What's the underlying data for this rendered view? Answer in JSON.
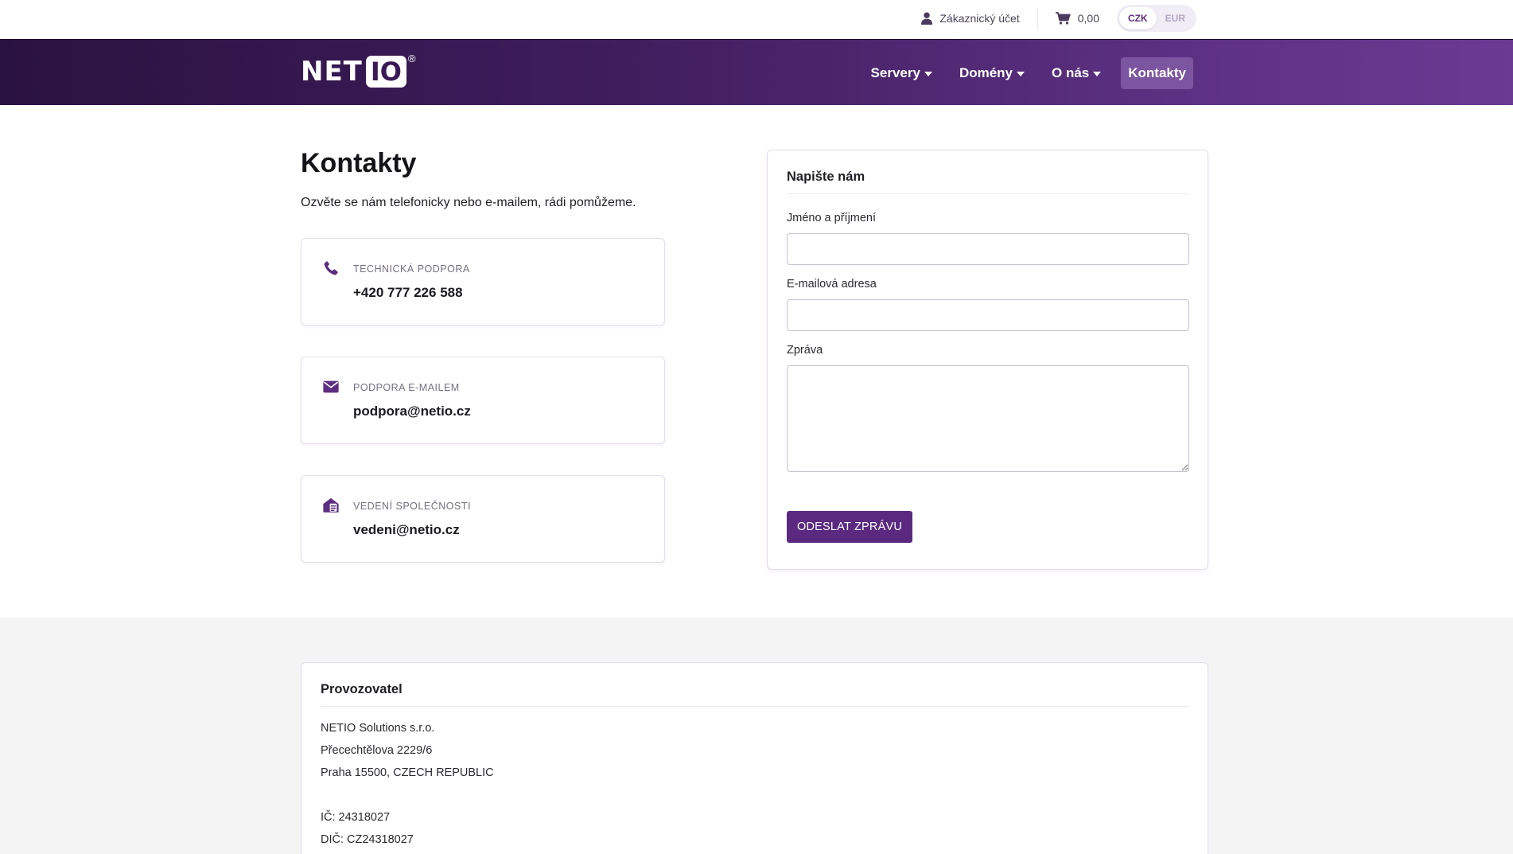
{
  "topbar": {
    "account_label": "Zákaznický účet",
    "cart_total": "0,00",
    "currencies": [
      "CZK",
      "EUR"
    ],
    "active_currency": "CZK"
  },
  "nav": {
    "logo_text": "NET",
    "logo_box_text": "IO",
    "logo_reg": "®",
    "items": [
      {
        "label": "Servery",
        "dropdown": true
      },
      {
        "label": "Domény",
        "dropdown": true
      },
      {
        "label": "O nás",
        "dropdown": true
      },
      {
        "label": "Kontakty",
        "dropdown": false,
        "active": true
      }
    ]
  },
  "main": {
    "title": "Kontakty",
    "subtitle": "Ozvěte se nám telefonicky nebo e-mailem, rádi pomůžeme.",
    "contacts": [
      {
        "icon": "phone-icon",
        "label": "TECHNICKÁ PODPORA",
        "value": "+420 777 226 588"
      },
      {
        "icon": "envelope-icon",
        "label": "PODPORA E-MAILEM",
        "value": "podpora@netio.cz"
      },
      {
        "icon": "envelope-open-text-icon",
        "label": "VEDENÍ SPOLEČNOSTI",
        "value": "vedeni@netio.cz"
      }
    ]
  },
  "form": {
    "heading": "Napište nám",
    "name_label": "Jméno a příjmení",
    "name_value": "",
    "email_label": "E-mailová adresa",
    "email_value": "",
    "message_label": "Zpráva",
    "message_value": "",
    "submit_label": "ODESLAT ZPRÁVU"
  },
  "operator": {
    "heading": "Provozovatel",
    "company": "NETIO Solutions s.r.o.",
    "street": "Přecechtělova 2229/6",
    "city": "Praha 15500, CZECH REPUBLIC",
    "ic": "IČ: 24318027",
    "dic": "DIČ: CZ24318027"
  },
  "colors": {
    "brand_purple": "#5b2a80",
    "nav_gradient_start": "#2a1240",
    "nav_gradient_end": "#6b3a93",
    "icon_purple": "#5d2d80"
  }
}
